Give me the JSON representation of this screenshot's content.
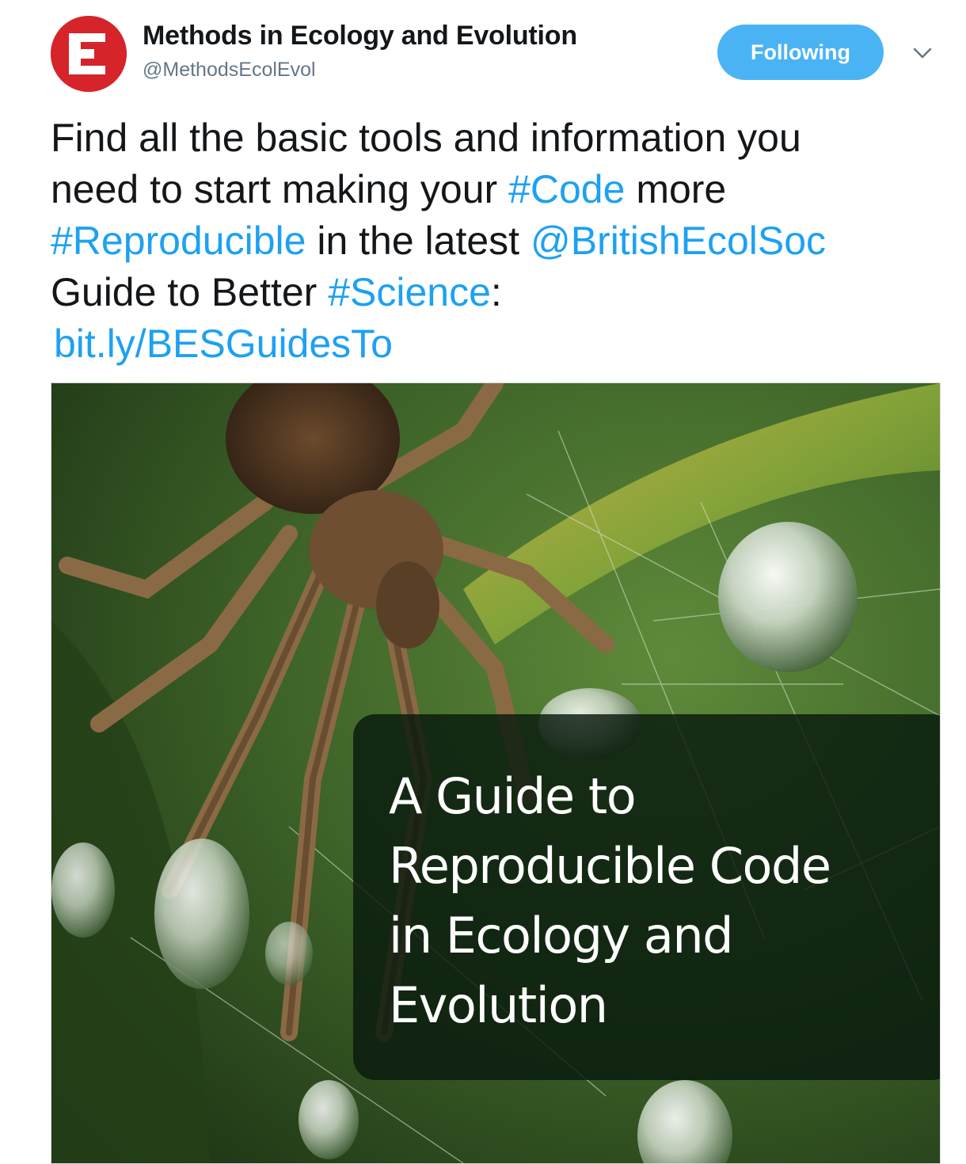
{
  "header": {
    "display_name": "Methods in Ecology and Evolution",
    "handle": "@MethodsEcolEvol",
    "follow_label": "Following",
    "avatar_letter": "E",
    "avatar_color": "#d5242a",
    "menu_icon": "chevron-down-icon"
  },
  "tweet": {
    "line1": "Find all the basic tools and information you",
    "line2_pre": "need to start making your ",
    "hashtag_code": "#Code",
    "line2_post": " more",
    "hashtag_reproducible": "#Reproducible",
    "line3_mid": " in the latest ",
    "mention": "@BritishEcolSoc",
    "line4_pre": "Guide to Better ",
    "hashtag_science": "#Science",
    "line4_post": ":",
    "url": "bit.ly/BESGuidesTo"
  },
  "media": {
    "cover_lines": [
      "A Guide to",
      "Reproducible Code",
      "in Ecology and",
      "Evolution"
    ]
  },
  "colors": {
    "link": "#1da1f2",
    "follow_button": "#4ab3f4",
    "text": "#14171a",
    "secondary": "#657786"
  }
}
